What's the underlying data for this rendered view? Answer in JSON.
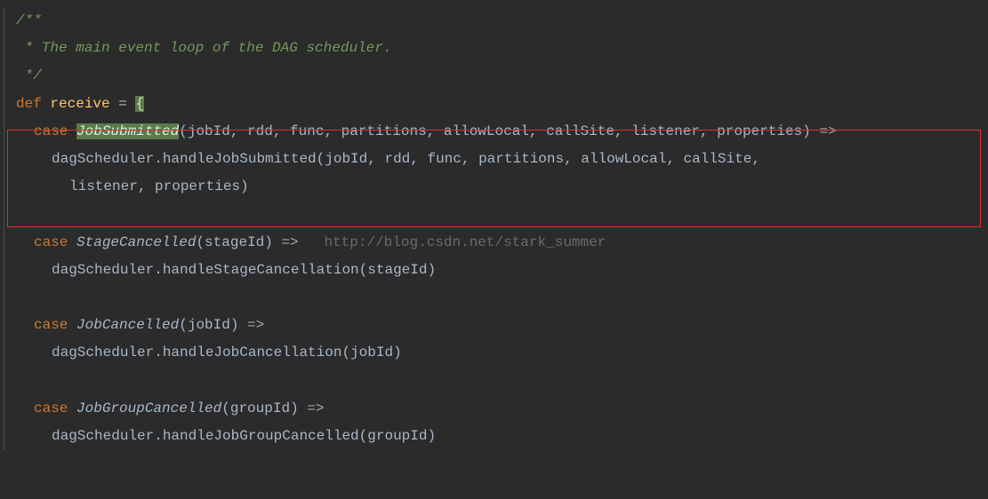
{
  "code": {
    "comment_open": "/**",
    "comment_text": " * The main event loop of the DAG scheduler.",
    "comment_close": " */",
    "def_kw": "def",
    "method_name": "receive",
    "equals": " = ",
    "open_brace": "{",
    "case_kw": "case",
    "job_submitted_class": "JobSubmitted",
    "job_submitted_params": "(jobId, rdd, func, partitions, allowLocal, callSite, listener, properties) ",
    "arrow": "=>",
    "job_submitted_body1": "dagScheduler.handleJobSubmitted(jobId, rdd, func, partitions, allowLocal, callSite,",
    "job_submitted_body2": "listener, properties)",
    "stage_cancelled_class": "StageCancelled",
    "stage_cancelled_params": "(stageId) ",
    "stage_cancelled_body": "dagScheduler.handleStageCancellation(stageId)",
    "watermark": "http://blog.csdn.net/stark_summer",
    "job_cancelled_class": "JobCancelled",
    "job_cancelled_params": "(jobId) ",
    "job_cancelled_body": "dagScheduler.handleJobCancellation(jobId)",
    "job_group_cancelled_class": "JobGroupCancelled",
    "job_group_cancelled_params": "(groupId) ",
    "job_group_cancelled_body": "dagScheduler.handleJobGroupCancelled(groupId)"
  }
}
